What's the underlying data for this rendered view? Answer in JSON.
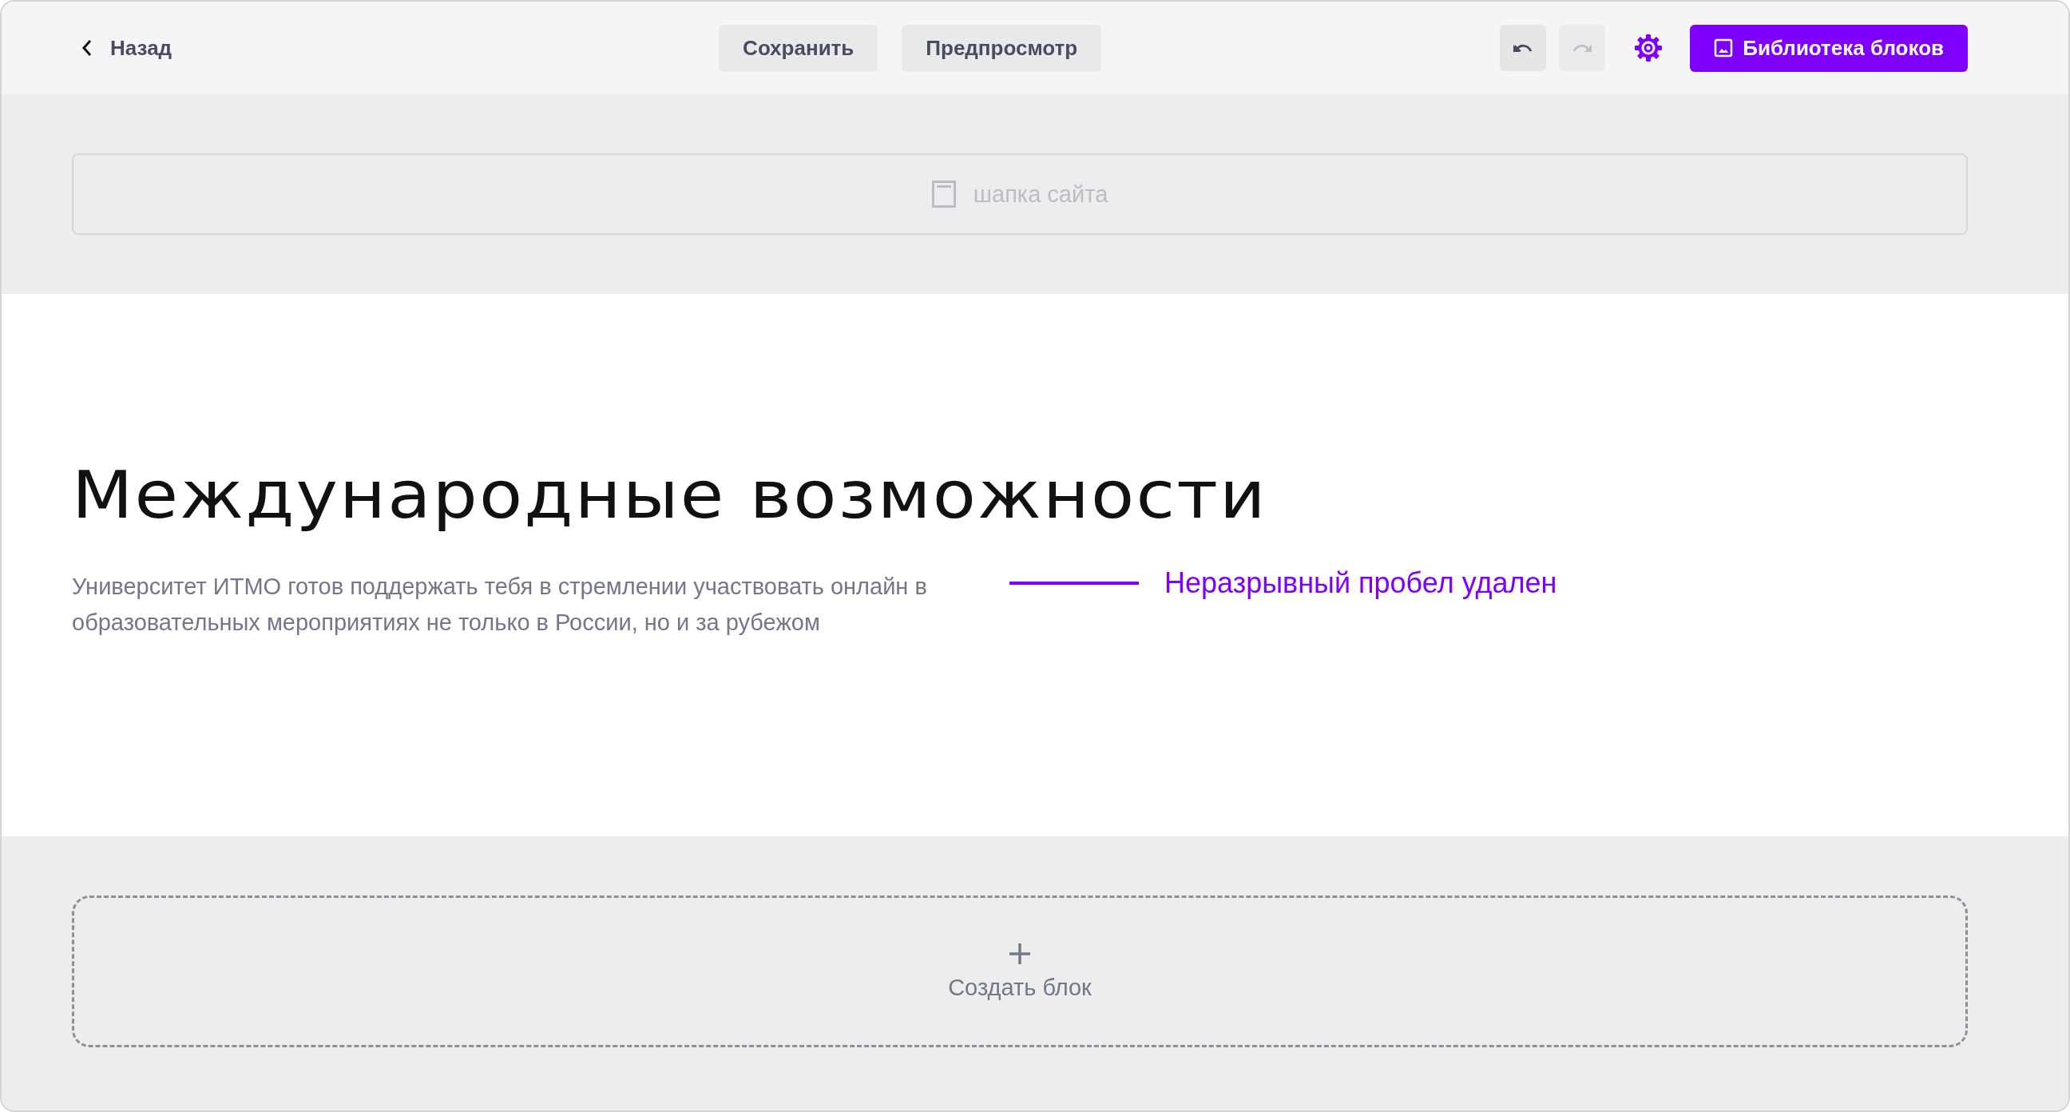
{
  "toolbar": {
    "back": {
      "label": "Назад"
    },
    "actions": [
      {
        "label": "Сохранить"
      },
      {
        "label": "Предпросмотр"
      }
    ],
    "history": [
      {
        "kind": "undo",
        "disabled": false
      },
      {
        "kind": "redo",
        "disabled": true
      }
    ],
    "library_button": {
      "label": "Библиотека блоков"
    }
  },
  "header_placeholder": {
    "label": "шапка сайта"
  },
  "content": {
    "title": "Международные возможности",
    "text": "Университет ИТМО готов поддержать тебя в стремлении участвовать онлайн в образовательных мероприятиях не только в России, но и за рубежом"
  },
  "annotation": {
    "text": "Неразрывный пробел удален"
  },
  "create_block": {
    "label": "Создать блок"
  }
}
